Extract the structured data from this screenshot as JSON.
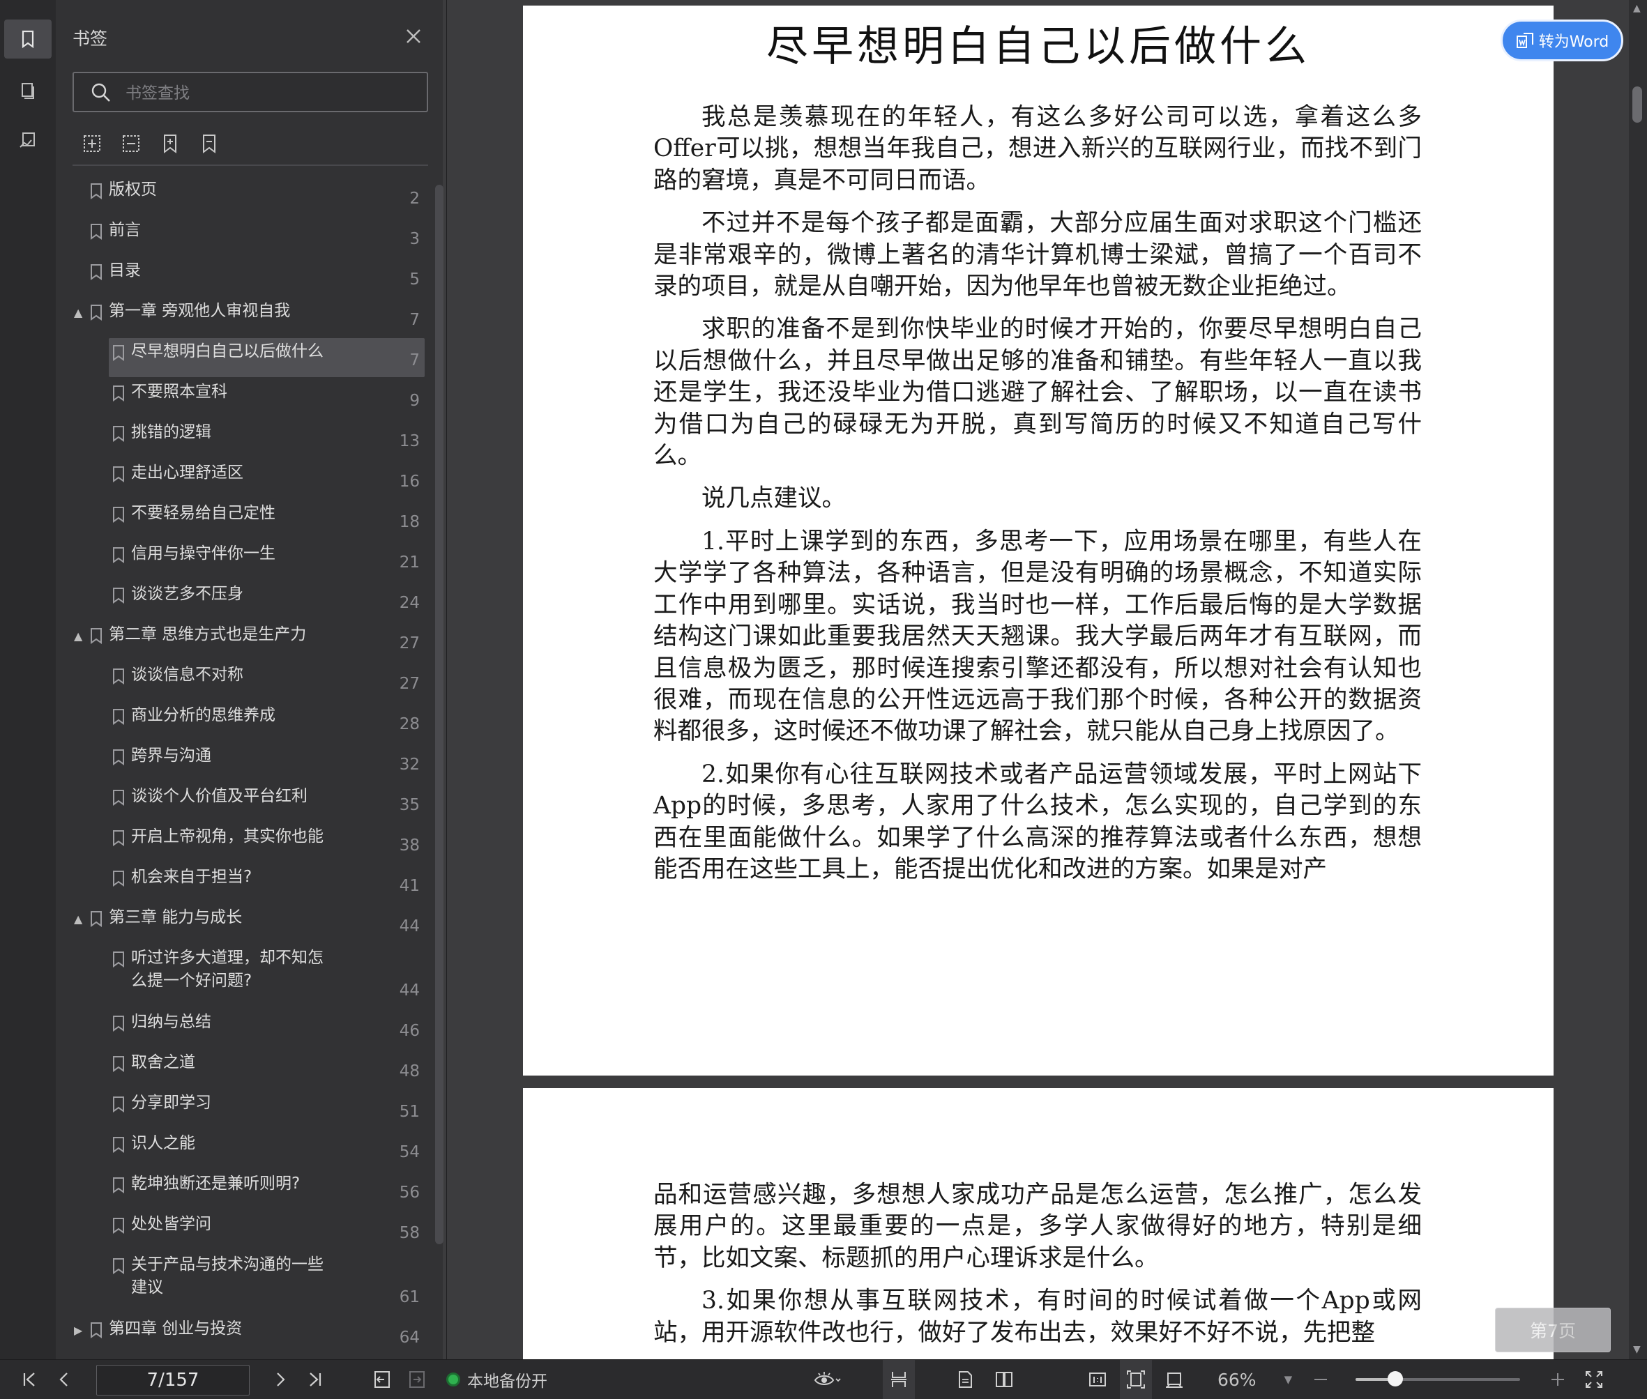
{
  "sidebar": {
    "title": "书签",
    "search_placeholder": "书签查找",
    "items": [
      {
        "label": "版权页",
        "page": "2",
        "level": 0,
        "arrow": ""
      },
      {
        "label": "前言",
        "page": "3",
        "level": 0,
        "arrow": ""
      },
      {
        "label": "目录",
        "page": "5",
        "level": 0,
        "arrow": ""
      },
      {
        "label": "第一章 旁观他人审视自我",
        "page": "7",
        "level": 0,
        "arrow": "▲"
      },
      {
        "label": "尽早想明白自己以后做什么",
        "page": "7",
        "level": 1,
        "arrow": "",
        "selected": true
      },
      {
        "label": "不要照本宣科",
        "page": "9",
        "level": 1,
        "arrow": ""
      },
      {
        "label": "挑错的逻辑",
        "page": "13",
        "level": 1,
        "arrow": ""
      },
      {
        "label": "走出心理舒适区",
        "page": "16",
        "level": 1,
        "arrow": ""
      },
      {
        "label": "不要轻易给自己定性",
        "page": "18",
        "level": 1,
        "arrow": ""
      },
      {
        "label": "信用与操守伴你一生",
        "page": "21",
        "level": 1,
        "arrow": ""
      },
      {
        "label": "谈谈艺多不压身",
        "page": "24",
        "level": 1,
        "arrow": ""
      },
      {
        "label": "第二章 思维方式也是生产力",
        "page": "27",
        "level": 0,
        "arrow": "▲"
      },
      {
        "label": "谈谈信息不对称",
        "page": "27",
        "level": 1,
        "arrow": ""
      },
      {
        "label": "商业分析的思维养成",
        "page": "28",
        "level": 1,
        "arrow": ""
      },
      {
        "label": "跨界与沟通",
        "page": "32",
        "level": 1,
        "arrow": ""
      },
      {
        "label": "谈谈个人价值及平台红利",
        "page": "35",
        "level": 1,
        "arrow": ""
      },
      {
        "label": "开启上帝视角，其实你也能",
        "page": "38",
        "level": 1,
        "arrow": ""
      },
      {
        "label": "机会来自于担当?",
        "page": "41",
        "level": 1,
        "arrow": ""
      },
      {
        "label": "第三章 能力与成长",
        "page": "44",
        "level": 0,
        "arrow": "▲"
      },
      {
        "label": "听过许多大道理，却不知怎么提一个好问题?",
        "page": "44",
        "level": 1,
        "arrow": "",
        "lines": [
          "听过许多大道理，却不知怎",
          "么提一个好问题?"
        ]
      },
      {
        "label": "归纳与总结",
        "page": "46",
        "level": 1,
        "arrow": ""
      },
      {
        "label": "取舍之道",
        "page": "48",
        "level": 1,
        "arrow": ""
      },
      {
        "label": "分享即学习",
        "page": "51",
        "level": 1,
        "arrow": ""
      },
      {
        "label": "识人之能",
        "page": "54",
        "level": 1,
        "arrow": ""
      },
      {
        "label": "乾坤独断还是兼听则明?",
        "page": "56",
        "level": 1,
        "arrow": ""
      },
      {
        "label": "处处皆学问",
        "page": "58",
        "level": 1,
        "arrow": ""
      },
      {
        "label": "关于产品与技术沟通的一些建议",
        "page": "61",
        "level": 1,
        "arrow": "",
        "lines": [
          "关于产品与技术沟通的一些",
          "建议"
        ]
      },
      {
        "label": "第四章 创业与投资",
        "page": "64",
        "level": 0,
        "arrow": "▶"
      }
    ]
  },
  "document": {
    "title": "尽早想明白自己以后做什么",
    "page1_paragraphs": [
      "我总是羡慕现在的年轻人，有这么多好公司可以选，拿着这么多Offer可以挑，想想当年我自己，想进入新兴的互联网行业，而找不到门路的窘境，真是不可同日而语。",
      "不过并不是每个孩子都是面霸，大部分应届生面对求职这个门槛还是非常艰辛的，微博上著名的清华计算机博士梁斌，曾搞了一个百司不录的项目，就是从自嘲开始，因为他早年也曾被无数企业拒绝过。",
      "求职的准备不是到你快毕业的时候才开始的，你要尽早想明白自己以后想做什么，并且尽早做出足够的准备和铺垫。有些年轻人一直以我还是学生，我还没毕业为借口逃避了解社会、了解职场，以一直在读书为借口为自己的碌碌无为开脱，真到写简历的时候又不知道自己写什么。",
      "说几点建议。",
      "1.平时上课学到的东西，多思考一下，应用场景在哪里，有些人在大学学了各种算法，各种语言，但是没有明确的场景概念，不知道实际工作中用到哪里。实话说，我当时也一样，工作后最后悔的是大学数据结构这门课如此重要我居然天天翘课。我大学最后两年才有互联网，而且信息极为匮乏，那时候连搜索引擎还都没有，所以想对社会有认知也很难，而现在信息的公开性远远高于我们那个时候，各种公开的数据资料都很多，这时候还不做功课了解社会，就只能从自己身上找原因了。",
      "2.如果你有心往互联网技术或者产品运营领域发展，平时上网站下App的时候，多思考，人家用了什么技术，怎么实现的，自己学到的东西在里面能做什么。如果学了什么高深的推荐算法或者什么东西，想想能否用在这些工具上，能否提出优化和改进的方案。如果是对产"
    ],
    "page2_paragraphs": [
      "品和运营感兴趣，多想想人家成功产品是怎么运营，怎么推广，怎么发展用户的。这里最重要的一点是，多学人家做得好的地方，特别是细节，比如文案、标题抓的用户心理诉求是什么。",
      "3.如果你想从事互联网技术，有时间的时候试着做一个App或网站，用开源软件改也行，做好了发布出去，效果好不好不说，先把整"
    ]
  },
  "to_word_label": "转为Word",
  "page_badge": "第7页",
  "bottombar": {
    "page_indicator": "7/157",
    "backup_label": "本地备份开",
    "zoom": "66%",
    "zoom_fraction": 0.24
  },
  "colors": {
    "accent": "#3f86ee",
    "backup_dot": "#2fb14f"
  }
}
